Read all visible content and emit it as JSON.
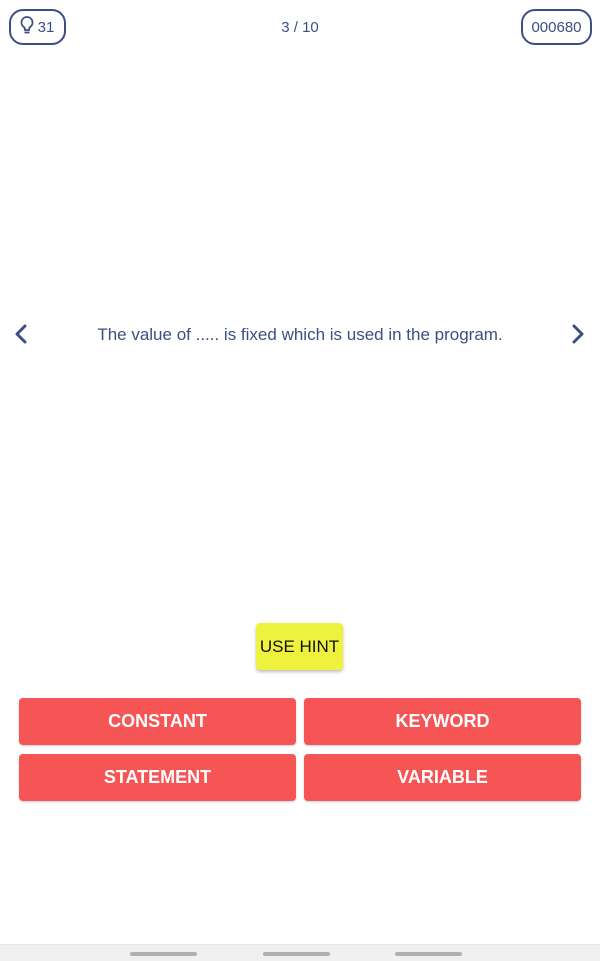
{
  "header": {
    "hints_count": "31",
    "hints_icon": "lightbulb-icon",
    "progress": "3 / 10",
    "score": "000680"
  },
  "question": {
    "text": "The value of ..... is fixed which is used in the program.",
    "prev_icon": "chevron-left-icon",
    "next_icon": "chevron-right-icon"
  },
  "hint_button": {
    "label": "USE HINT"
  },
  "answers": [
    {
      "label": "CONSTANT"
    },
    {
      "label": "KEYWORD"
    },
    {
      "label": "STATEMENT"
    },
    {
      "label": "VARIABLE"
    }
  ],
  "colors": {
    "primary_text": "#3a5082",
    "answer_button": "#f65556",
    "hint_button": "#eef23f"
  }
}
